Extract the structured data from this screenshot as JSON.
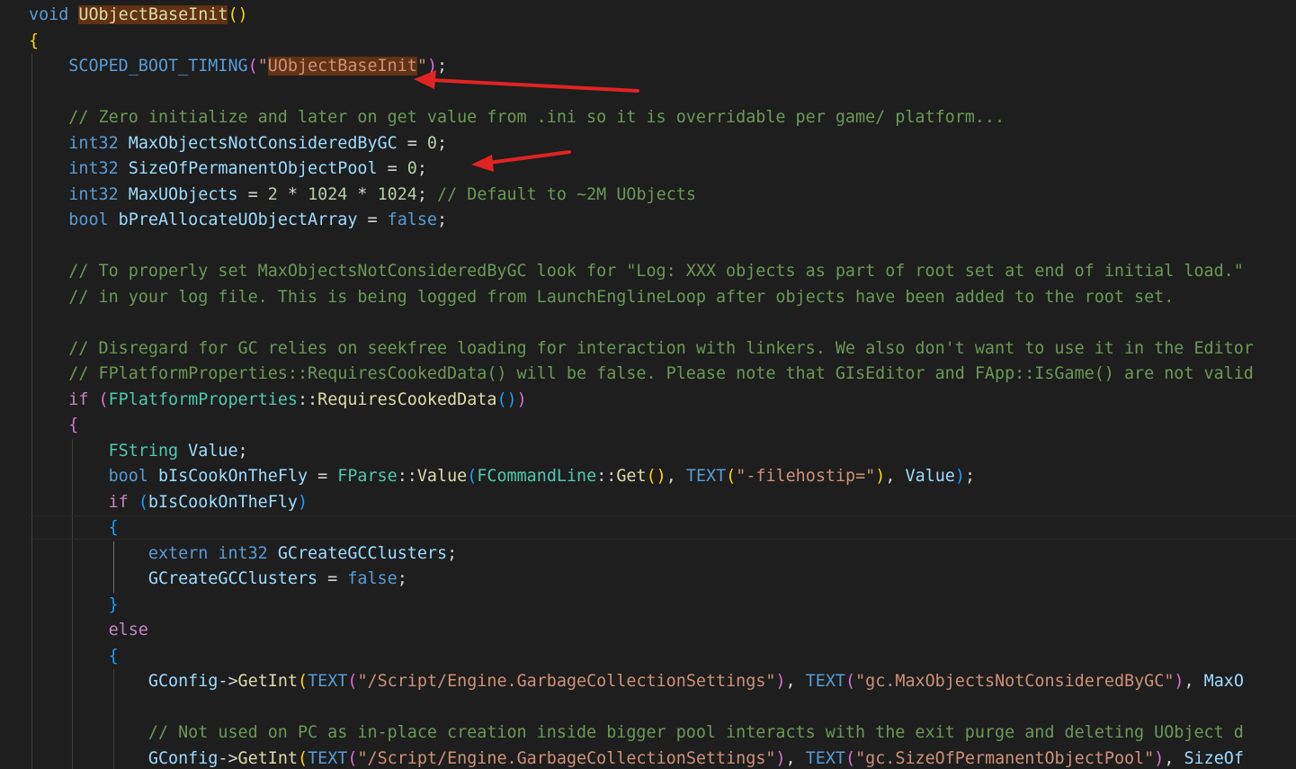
{
  "code": {
    "fn_return_type": "void",
    "fn_name": "UObjectBaseInit",
    "macro_name": "SCOPED_BOOT_TIMING",
    "boot_timing_label": "UObjectBaseInit",
    "comment_zero_init": "// Zero initialize and later on get value from .ini so it is overridable per game/ platform...",
    "var_max_objects_not_considered": "MaxObjectsNotConsideredByGC",
    "var_size_of_permanent_pool": "SizeOfPermanentObjectPool",
    "var_max_uobjects": "MaxUObjects",
    "comment_default_2m": "// Default to ~2M UObjects",
    "var_preallocate": "bPreAllocateUObjectArray",
    "comment_proper_set_1": "// To properly set MaxObjectsNotConsideredByGC look for \"Log: XXX objects as part of root set at end of initial load.\"",
    "comment_proper_set_2": "// in your log file. This is being logged from LaunchEnglineLoop after objects have been added to the root set.",
    "comment_disregard_1": "// Disregard for GC relies on seekfree loading for interaction with linkers. We also don't want to use it in the Editor",
    "comment_disregard_2": "// FPlatformProperties::RequiresCookedData() will be false. Please note that GIsEditor and FApp::IsGame() are not valid",
    "class_platform_properties": "FPlatformProperties",
    "fn_requires_cooked": "RequiresCookedData",
    "type_fstring": "FString",
    "var_value": "Value",
    "var_cook_on_the_fly": "bIsCookOnTheFly",
    "class_fparse": "FParse",
    "fn_value": "Value",
    "class_command_line": "FCommandLine",
    "fn_get": "Get",
    "macro_text": "TEXT",
    "str_filehostip": "\"-filehostip=\"",
    "var_gcreate_clusters": "GCreateGCClusters",
    "var_gconfig": "GConfig",
    "fn_getint": "GetInt",
    "str_gc_settings": "\"/Script/Engine.GarbageCollectionSettings\"",
    "str_gc_max_objects": "\"gc.MaxObjectsNotConsideredByGC\"",
    "var_max_objects_truncated": "MaxO",
    "comment_not_used_on_pc": "// Not used on PC as in-place creation inside bigger pool interacts with the exit purge and deleting UObject d",
    "str_gc_size_of_pool": "\"gc.SizeOfPermanentObjectPool\"",
    "var_size_of_truncated": "SizeOf"
  },
  "colors": {
    "background": "#1e1e1e",
    "keyword": "#569cd6",
    "control_keyword": "#c586c0",
    "type": "#4ec9b0",
    "function": "#dcdcaa",
    "variable": "#9cdcfe",
    "number": "#b5cea8",
    "string": "#ce9178",
    "comment": "#6a9955",
    "annotation_arrow": "#e02424"
  }
}
